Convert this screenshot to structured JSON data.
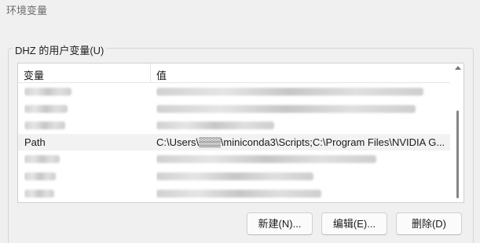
{
  "window": {
    "title": "环境变量"
  },
  "user_vars": {
    "group_label": "DHZ 的用户变量(U)",
    "columns": {
      "variable": "变量",
      "value": "值"
    },
    "rows": [
      {
        "variable": "",
        "value": "",
        "redacted": true,
        "selected": false
      },
      {
        "variable": "",
        "value": "",
        "redacted": true,
        "selected": false
      },
      {
        "variable": "",
        "value": "",
        "redacted": true,
        "selected": false
      },
      {
        "variable": "Path",
        "value": "C:\\Users\\▒▒▒\\miniconda3\\Scripts;C:\\Program Files\\NVIDIA G...",
        "redacted": false,
        "selected": true
      },
      {
        "variable": "",
        "value": "",
        "redacted": true,
        "selected": false
      },
      {
        "variable": "",
        "value": "",
        "redacted": true,
        "selected": false
      },
      {
        "variable": "",
        "value": "",
        "redacted": true,
        "selected": false
      }
    ]
  },
  "buttons": {
    "new_label": "新建(N)...",
    "edit_label": "编辑(E)...",
    "delete_label": "删除(D)"
  }
}
